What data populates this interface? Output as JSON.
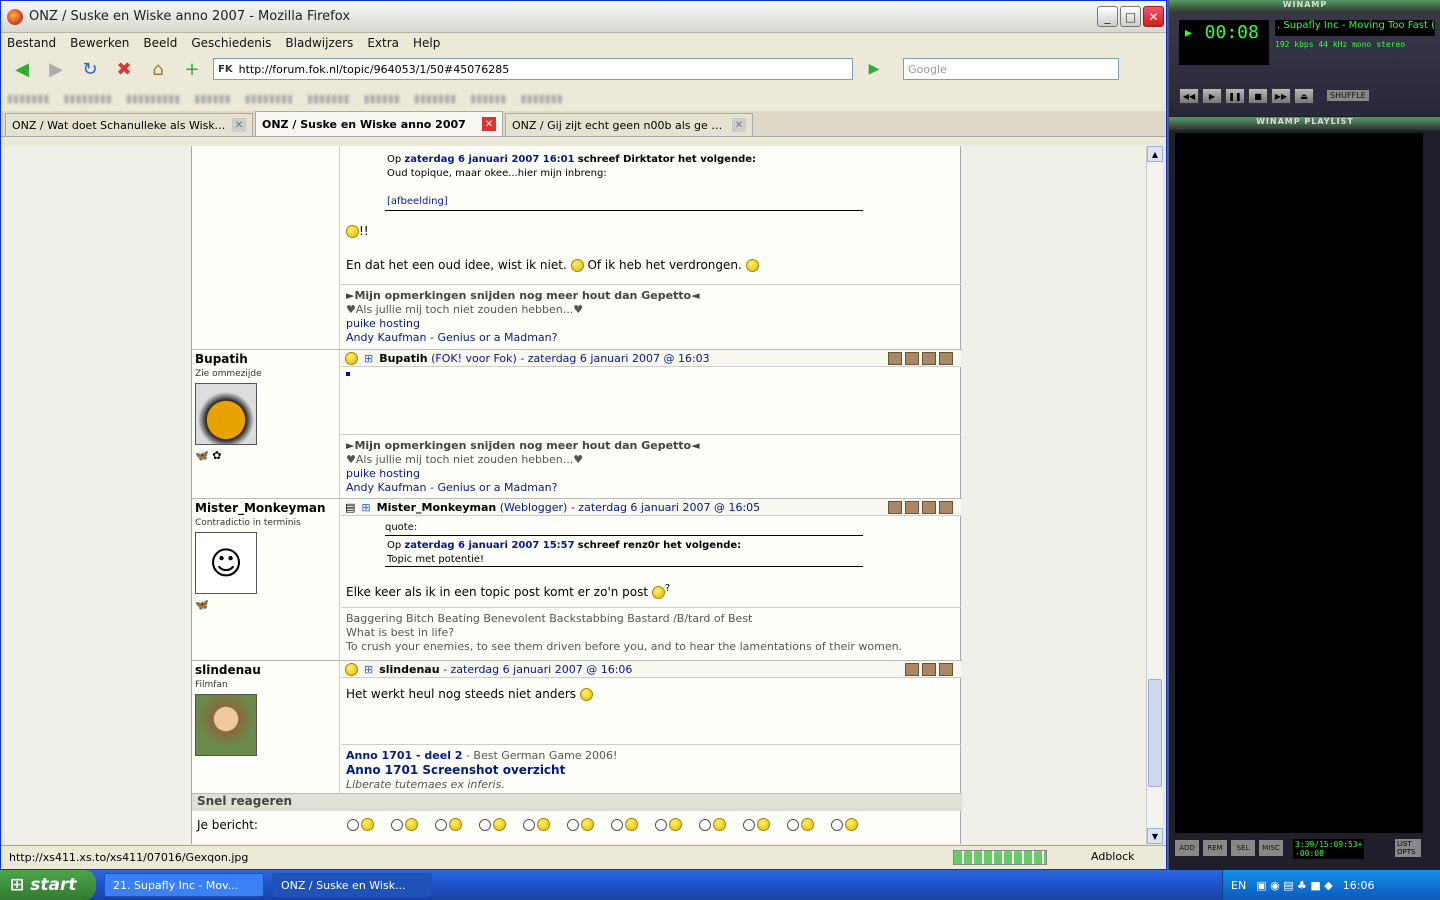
{
  "window": {
    "title": "ONZ / Suske en Wiske anno 2007 - Mozilla Firefox"
  },
  "menu": [
    "Bestand",
    "Bewerken",
    "Beeld",
    "Geschiedenis",
    "Bladwijzers",
    "Extra",
    "Help"
  ],
  "nav": {
    "url": "http://forum.fok.nl/topic/964053/1/50#45076285",
    "search_placeholder": "Google"
  },
  "tabs": [
    {
      "label": "ONZ / Wat doet Schanulleke als Wiske..."
    },
    {
      "label": "ONZ / Suske en Wiske anno 2007"
    },
    {
      "label": "ONZ / Gij zijt echt geen n00b als ge hi..."
    }
  ],
  "post1": {
    "quote_header_prefix": "Op",
    "quote_date": "zaterdag 6 januari 2007 16:01",
    "quote_header_suffix": "schreef Dirktator het volgende:",
    "quote_line": "Oud topique, maar okee...hier mijn inbreng:",
    "quote_link": "[afbeelding]",
    "exclaim": "!!",
    "text": "En dat het een oud idee, wist ik niet.",
    "text2": "Of ik heb het verdrongen.",
    "sig1": "►Mijn opmerkingen snijden nog meer hout dan Gepetto◄",
    "sig2": "♥Als jullie mij toch niet zouden hebben...♥",
    "sig3": "puike hosting",
    "sig4": "Andy Kaufman - Genius or a Madman?"
  },
  "post2": {
    "username": "Bupatih",
    "usertitle": "Zie ommezijde",
    "header_name": "Bupatih",
    "header_group": "(FOK! voor Fok)",
    "header_date": "- zaterdag 6 januari 2007 @ 16:03",
    "sig1": "►Mijn opmerkingen snijden nog meer hout dan Gepetto◄",
    "sig2": "♥Als jullie mij toch niet zouden hebben...♥",
    "sig3": "puike hosting",
    "sig4": "Andy Kaufman - Genius or a Madman?"
  },
  "post3": {
    "username": "Mister_Monkeyman",
    "usertitle": "Contradictio in terminis",
    "header_name": "Mister_Monkeyman",
    "header_group": "(Weblogger)",
    "header_date": "- zaterdag 6 januari 2007 @ 16:05",
    "quote_label": "quote:",
    "quote_header_prefix": "Op",
    "quote_date": "zaterdag 6 januari 2007 15:57",
    "quote_header_suffix": "schreef renz0r het volgende:",
    "quote_line": "Topic met potentie!",
    "text": "Elke keer als ik in een topic post komt er zo'n post",
    "qmark": "?",
    "sig1": "Baggering Bitch Beating Benevolent Backstabbing Bastard /B/tard of Best",
    "sig2": "What is best in life?",
    "sig3": "To crush your enemies, to see them driven before you, and to hear the lamentations of their women."
  },
  "post4": {
    "username": "slindenau",
    "usertitle": "Filmfan",
    "header_name": "slindenau",
    "header_date": "- zaterdag 6 januari 2007 @ 16:06",
    "text": "Het werkt heul nog steeds niet anders",
    "sig1a": "Anno 1701 - deel 2",
    "sig1b": " - Best German Game 2006!",
    "sig2": "Anno 1701 Screenshot overzicht",
    "sig3": "Liberate tutemaes ex inferis."
  },
  "reply": {
    "title": "Snel reageren",
    "label": "Je bericht:"
  },
  "status": {
    "text": "http://xs411.xs.to/xs411/07016/Gexqon.jpg",
    "adblock": "Adblock"
  },
  "winamp": {
    "title": "WINAMP",
    "time": "▸ 00:08",
    "song": ". Supafly Inc - Moving Too Fast (",
    "kbps": "192",
    "khz": "44",
    "mono": "mono",
    "stereo": "stereo",
    "shuffle": "SHUFFLE",
    "playlist_title": "WINAMP PLAYLIST",
    "pl_buttons": [
      "ADD",
      "REM",
      "SEL",
      "MISC"
    ],
    "pl_time": "3:39/15:09:53+",
    "pl_time2": "-00:08",
    "list_opts": "LIST OPTS"
  },
  "taskbar": {
    "start": "start",
    "tasks": [
      "21. Supafly Inc - Mov...",
      "ONZ / Suske en Wisk..."
    ],
    "lang": "EN",
    "clock": "16:06"
  }
}
